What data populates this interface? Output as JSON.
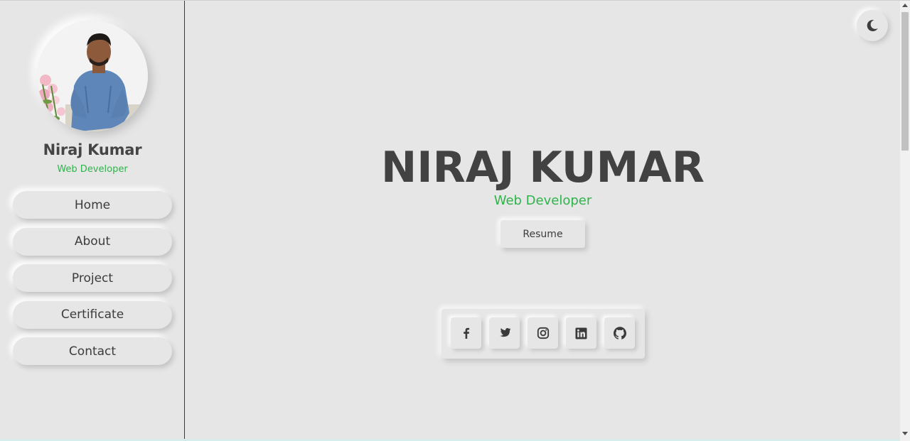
{
  "sidebar": {
    "name": "Niraj Kumar",
    "role": "Web Developer",
    "items": [
      {
        "label": "Home"
      },
      {
        "label": "About"
      },
      {
        "label": "Project"
      },
      {
        "label": "Certificate"
      },
      {
        "label": "Contact"
      }
    ]
  },
  "hero": {
    "name": "NIRAJ KUMAR",
    "role": "Web Developer",
    "resume_label": "Resume"
  },
  "social": [
    "facebook-icon",
    "twitter-icon",
    "instagram-icon",
    "linkedin-icon",
    "github-icon"
  ],
  "theme_toggle_icon": "moon-icon",
  "colors": {
    "background": "#e6e6e6",
    "accent": "#2fb34a",
    "text": "#444444"
  }
}
